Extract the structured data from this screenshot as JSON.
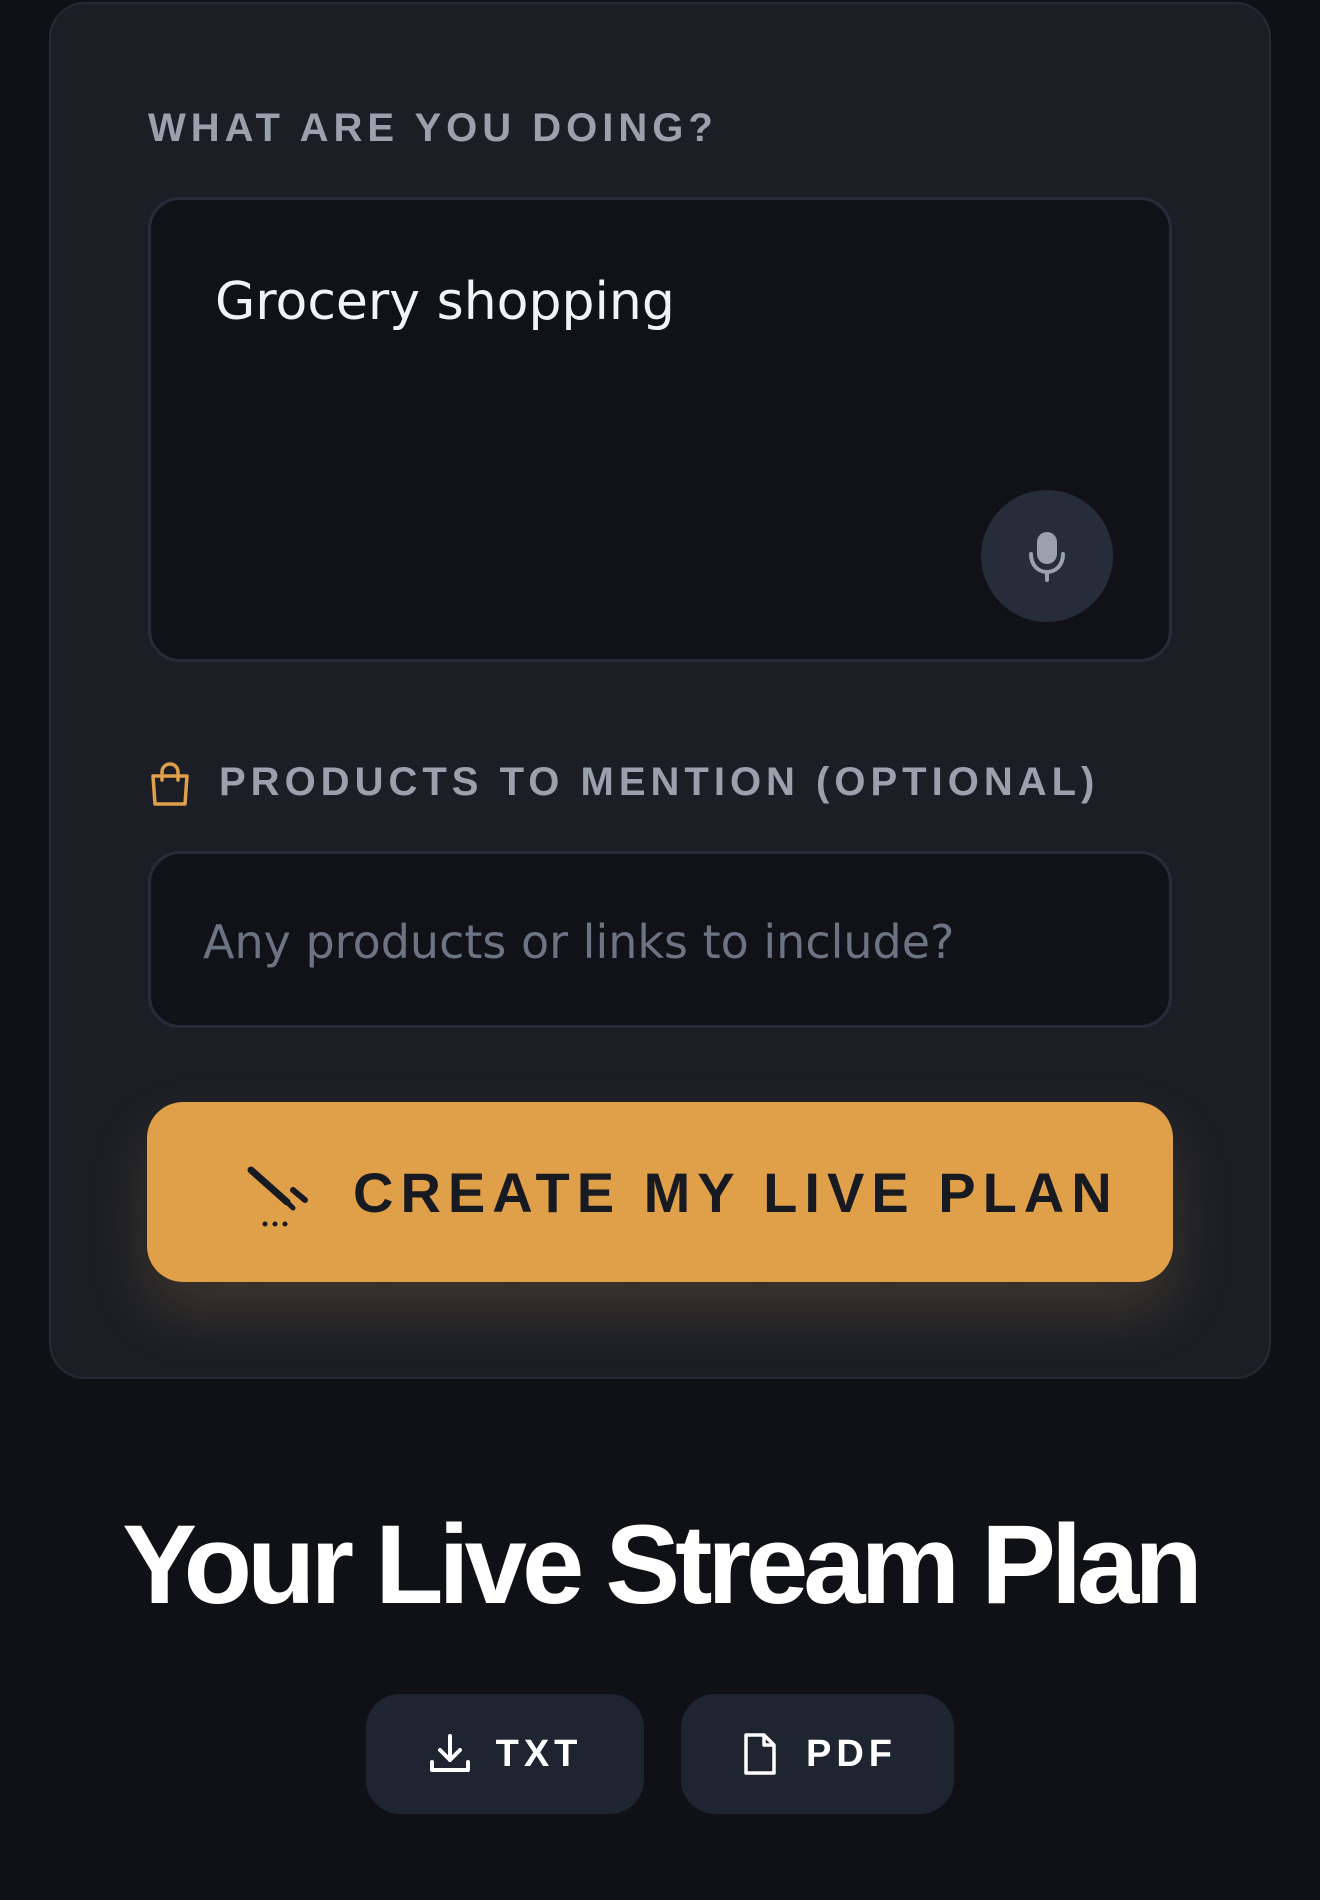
{
  "form": {
    "activity_label": "WHAT ARE YOU DOING?",
    "activity_value": "Grocery shopping",
    "products_label": "PRODUCTS TO MENTION (OPTIONAL)",
    "products_placeholder": "Any products or links to include?",
    "submit_label": "CREATE MY LIVE PLAN"
  },
  "plan": {
    "title": "Your Live Stream Plan",
    "export_txt_label": "TXT",
    "export_pdf_label": "PDF"
  },
  "icons": {
    "mic": "microphone-icon",
    "bag": "shopping-bag-icon",
    "wand": "magic-wand-icon",
    "download": "download-icon",
    "file": "file-icon"
  },
  "colors": {
    "background": "#0f1116",
    "card": "#1b1e25",
    "field": "#101217",
    "accent": "#e09f49",
    "muted_label": "#9aa1ad",
    "button_dark": "#1f2431"
  }
}
